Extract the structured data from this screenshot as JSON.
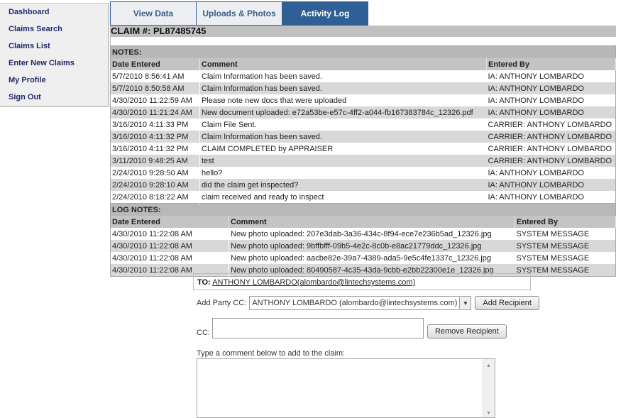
{
  "sidebar": {
    "items": [
      {
        "label": "Dashboard"
      },
      {
        "label": "Claims Search"
      },
      {
        "label": "Claims List"
      },
      {
        "label": "Enter New Claims"
      },
      {
        "label": "My Profile"
      },
      {
        "label": "Sign Out"
      }
    ]
  },
  "tabs": [
    {
      "label": "View Data",
      "active": false
    },
    {
      "label": "Uploads & Photos",
      "active": false
    },
    {
      "label": "Activity Log",
      "active": true
    }
  ],
  "claim": {
    "title": "CLAIM #: PL87485745"
  },
  "notes": {
    "section_label": "NOTES:",
    "columns": [
      "Date Entered",
      "Comment",
      "Entered By"
    ],
    "rows": [
      {
        "date": "5/7/2010 8:56:41 AM",
        "comment": "Claim Information has been saved.",
        "by": "IA: ANTHONY LOMBARDO"
      },
      {
        "date": "5/7/2010 8:50:58 AM",
        "comment": "Claim Information has been saved.",
        "by": "IA: ANTHONY LOMBARDO"
      },
      {
        "date": "4/30/2010 11:22:59 AM",
        "comment": "Please note new docs that were uploaded",
        "by": "IA: ANTHONY LOMBARDO"
      },
      {
        "date": "4/30/2010 11:21:24 AM",
        "comment": "New document uploaded: e72a53be-e57c-4ff2-a044-fb167383784c_12326.pdf",
        "by": "IA: ANTHONY LOMBARDO"
      },
      {
        "date": "3/16/2010 4:11:33 PM",
        "comment": "Claim File Sent.",
        "by": "CARRIER: ANTHONY LOMBARDO"
      },
      {
        "date": "3/16/2010 4:11:32 PM",
        "comment": "Claim Information has been saved.",
        "by": "CARRIER: ANTHONY LOMBARDO"
      },
      {
        "date": "3/16/2010 4:11:32 PM",
        "comment": "CLAIM COMPLETED by APPRAISER",
        "by": "CARRIER: ANTHONY LOMBARDO"
      },
      {
        "date": "3/11/2010 9:48:25 AM",
        "comment": "test",
        "by": "CARRIER: ANTHONY LOMBARDO"
      },
      {
        "date": "2/24/2010 9:28:50 AM",
        "comment": "hello?",
        "by": "IA: ANTHONY LOMBARDO"
      },
      {
        "date": "2/24/2010 9:28:10 AM",
        "comment": "did the claim get inspected?",
        "by": "IA: ANTHONY LOMBARDO"
      },
      {
        "date": "2/24/2010 8:18:22 AM",
        "comment": "claim received and ready to inspect",
        "by": "IA: ANTHONY LOMBARDO"
      }
    ]
  },
  "log_notes": {
    "section_label": "LOG NOTES:",
    "columns": [
      "Date Entered",
      "Comment",
      "Entered By"
    ],
    "rows": [
      {
        "date": "4/30/2010 11:22:08 AM",
        "comment": "New photo uploaded: 207e3dab-3a36-434c-8f94-ece7e236b5ad_12326.jpg",
        "by": "SYSTEM MESSAGE"
      },
      {
        "date": "4/30/2010 11:22:08 AM",
        "comment": "New photo uploaded: 9bffbfff-09b5-4e2c-8c0b-e8ac21779ddc_12326.jpg",
        "by": "SYSTEM MESSAGE"
      },
      {
        "date": "4/30/2010 11:22:08 AM",
        "comment": "New photo uploaded: aacbe82e-39a7-4389-ada5-9e5c4fe1337c_12326.jpg",
        "by": "SYSTEM MESSAGE"
      },
      {
        "date": "4/30/2010 11:22:08 AM",
        "comment": "New photo uploaded: 80490587-4c35-43da-9cbb-e2bb22300e1e_12326.jpg",
        "by": "SYSTEM MESSAGE"
      }
    ]
  },
  "recipients": {
    "to_label": "TO:",
    "to_value": "ANTHONY LOMBARDO(alombardo@lintechsystems.com)",
    "add_party_label": "Add Party CC:",
    "add_party_selected": "ANTHONY LOMBARDO (alombardo@lintechsystems.com)",
    "add_button": "Add Recipient",
    "cc_label": "CC:",
    "cc_value": "",
    "remove_button": "Remove Recipient"
  },
  "comment": {
    "label": "Type a comment below to add to the claim:",
    "value": ""
  },
  "icons": {
    "dropdown": "chevron-down-icon",
    "scroll_up": "scroll-up-icon",
    "scroll_down": "scroll-down-icon"
  }
}
